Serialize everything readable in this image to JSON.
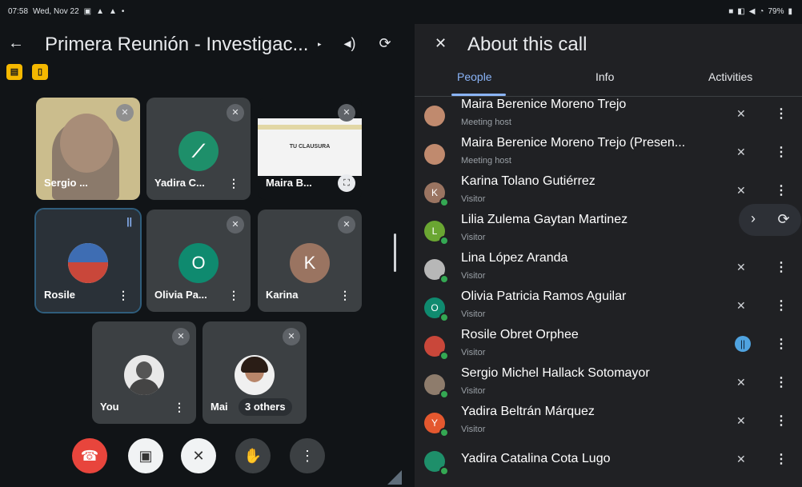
{
  "status_bar": {
    "time": "07:58",
    "date": "Wed, Nov 22",
    "battery": "79%"
  },
  "meeting": {
    "title": "Primera Reunión - Investigac...",
    "icons": [
      "volume-icon",
      "camera-switch-icon"
    ]
  },
  "tiles": [
    {
      "name": "Sergio ...",
      "kind": "video",
      "muted": true
    },
    {
      "name": "Yadira C...",
      "kind": "avatar",
      "initial": "",
      "color": "#1e8f6a",
      "muted": true
    },
    {
      "name": "Maira B...",
      "kind": "presentation",
      "slide_text": "TU CLAUSURA",
      "muted": true
    },
    {
      "name": "Rosile",
      "kind": "avatar",
      "initial": "",
      "color": "#c9473a",
      "speaking": true
    },
    {
      "name": "Olivia Pa...",
      "kind": "avatar",
      "initial": "O",
      "color": "#0f8a6f",
      "muted": true
    },
    {
      "name": "Karina",
      "kind": "avatar",
      "initial": "K",
      "color": "#9a7461",
      "muted": true
    },
    {
      "name": "You",
      "kind": "avatar",
      "initial": "",
      "color": "#777777",
      "muted": true
    },
    {
      "name": "Mai",
      "kind": "avatar",
      "initial": "",
      "color": "#b8866a",
      "muted": true
    }
  ],
  "others_chip": "3 others",
  "controls": [
    "end-call",
    "camera-off",
    "mic-off",
    "raise-hand",
    "more-options"
  ],
  "panel": {
    "title": "About this call",
    "tabs": [
      "People",
      "Info",
      "Activities"
    ],
    "selected_tab": "People"
  },
  "people": [
    {
      "name": "Maira Berenice Moreno Trejo",
      "role": "Meeting host",
      "initial": "",
      "color": "#c08a6e",
      "mic": "muted"
    },
    {
      "name": "Maira Berenice Moreno Trejo (Presen...",
      "role": "Meeting host",
      "initial": "",
      "color": "#c08a6e",
      "mic": "muted"
    },
    {
      "name": "Karina Tolano Gutiérrez",
      "role": "Visitor",
      "initial": "K",
      "color": "#9a7461",
      "mic": "muted"
    },
    {
      "name": "Lilia Zulema Gaytan Martinez",
      "role": "Visitor",
      "initial": "L",
      "color": "#6aa632",
      "mic": "muted"
    },
    {
      "name": "Lina López Aranda",
      "role": "Visitor",
      "initial": "",
      "color": "#b7b7b7",
      "mic": "muted"
    },
    {
      "name": "Olivia Patricia Ramos Aguilar",
      "role": "Visitor",
      "initial": "O",
      "color": "#0f8a6f",
      "mic": "muted"
    },
    {
      "name": "Rosile Obret Orphee",
      "role": "Visitor",
      "initial": "",
      "color": "#c9473a",
      "mic": "speaking"
    },
    {
      "name": "Sergio Michel Hallack Sotomayor",
      "role": "Visitor",
      "initial": "",
      "color": "#8e7c6c",
      "mic": "muted"
    },
    {
      "name": "Yadira Beltrán Márquez",
      "role": "Visitor",
      "initial": "Y",
      "color": "#e4582f",
      "mic": "muted"
    },
    {
      "name": "Yadira Catalina Cota Lugo",
      "role": "",
      "initial": "",
      "color": "#1e8f6a",
      "mic": "muted"
    }
  ]
}
